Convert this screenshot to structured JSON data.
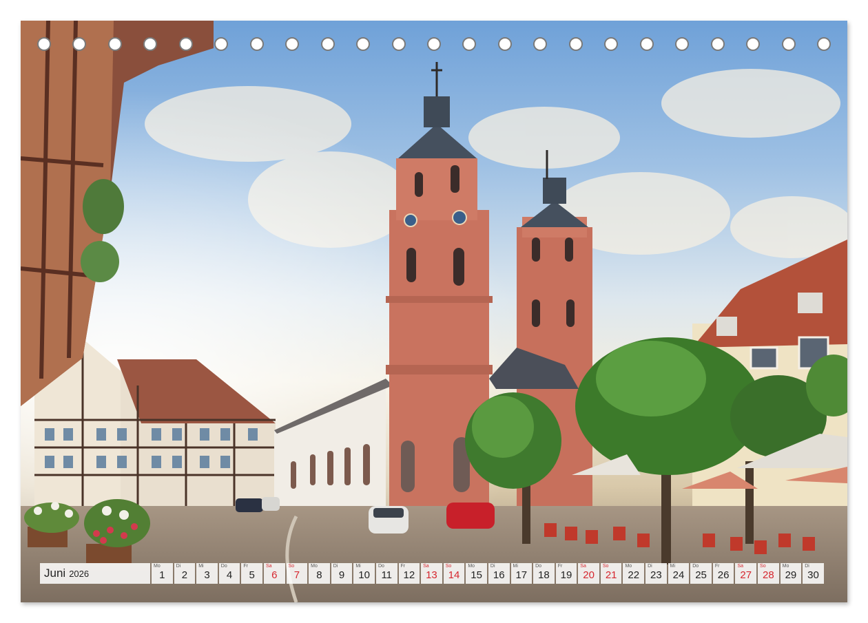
{
  "calendar": {
    "month": "Juni",
    "year": "2026",
    "weekend_color": "#d6262e",
    "days": [
      {
        "wd": "Mo",
        "num": "1",
        "weekend": false
      },
      {
        "wd": "Di",
        "num": "2",
        "weekend": false
      },
      {
        "wd": "Mi",
        "num": "3",
        "weekend": false
      },
      {
        "wd": "Do",
        "num": "4",
        "weekend": false
      },
      {
        "wd": "Fr",
        "num": "5",
        "weekend": false
      },
      {
        "wd": "Sa",
        "num": "6",
        "weekend": true
      },
      {
        "wd": "So",
        "num": "7",
        "weekend": true
      },
      {
        "wd": "Mo",
        "num": "8",
        "weekend": false
      },
      {
        "wd": "Di",
        "num": "9",
        "weekend": false
      },
      {
        "wd": "Mi",
        "num": "10",
        "weekend": false
      },
      {
        "wd": "Do",
        "num": "11",
        "weekend": false
      },
      {
        "wd": "Fr",
        "num": "12",
        "weekend": false
      },
      {
        "wd": "Sa",
        "num": "13",
        "weekend": true
      },
      {
        "wd": "So",
        "num": "14",
        "weekend": true
      },
      {
        "wd": "Mo",
        "num": "15",
        "weekend": false
      },
      {
        "wd": "Di",
        "num": "16",
        "weekend": false
      },
      {
        "wd": "Mi",
        "num": "17",
        "weekend": false
      },
      {
        "wd": "Do",
        "num": "18",
        "weekend": false
      },
      {
        "wd": "Fr",
        "num": "19",
        "weekend": false
      },
      {
        "wd": "Sa",
        "num": "20",
        "weekend": true
      },
      {
        "wd": "So",
        "num": "21",
        "weekend": true
      },
      {
        "wd": "Mo",
        "num": "22",
        "weekend": false
      },
      {
        "wd": "Di",
        "num": "23",
        "weekend": false
      },
      {
        "wd": "Mi",
        "num": "24",
        "weekend": false
      },
      {
        "wd": "Do",
        "num": "25",
        "weekend": false
      },
      {
        "wd": "Fr",
        "num": "26",
        "weekend": false
      },
      {
        "wd": "Sa",
        "num": "27",
        "weekend": true
      },
      {
        "wd": "So",
        "num": "28",
        "weekend": true
      },
      {
        "wd": "Mo",
        "num": "29",
        "weekend": false
      },
      {
        "wd": "Di",
        "num": "30",
        "weekend": false
      }
    ]
  },
  "binding": {
    "hole_count": 23
  }
}
